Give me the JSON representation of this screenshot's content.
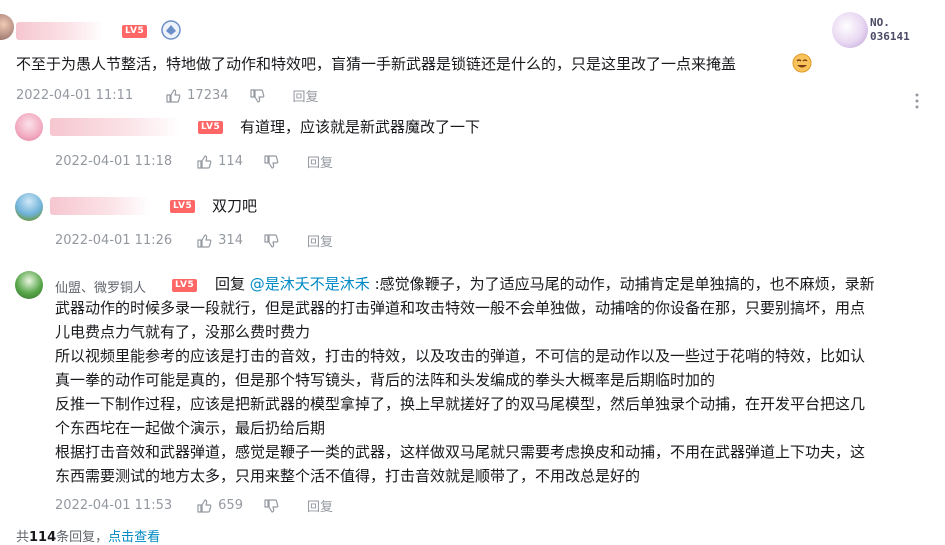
{
  "main_comment": {
    "text": "不至于为愚人节整活，特地做了动作和特效吧，盲猜一手新武器是锁链还是什么的，只是这里改了一点来掩盖",
    "time": "2022-04-01 11:11",
    "likes": "17234",
    "reply_label": "回复",
    "level": "LV5",
    "badge_no_label": "NO.",
    "badge_no_value": "036141"
  },
  "replies": [
    {
      "level": "LV5",
      "text": "有道理，应该就是新武器魔改了一下",
      "time": "2022-04-01 11:18",
      "likes": "114",
      "reply_label": "回复"
    },
    {
      "level": "LV5",
      "text": "双刀吧",
      "time": "2022-04-01 11:26",
      "likes": "314",
      "reply_label": "回复"
    },
    {
      "name": "仙盟、微罗铜人",
      "level": "LV5",
      "reply_prefix": "回复 ",
      "mention": "@是沐夭不是沐禾",
      "line1": " :感觉像鞭子，为了适应马尾的动作，动捕肯定是单独搞的，也不麻烦，录新",
      "line2": "武器动作的时候多录一段就行，但是武器的打击弹道和攻击特效一般不会单独做，动捕啥的你设备在那，只要别搞坏，用点",
      "line3": "儿电费点力气就有了，没那么费时费力",
      "line4": "所以视频里能参考的应该是打击的音效，打击的特效，以及攻击的弹道，不可信的是动作以及一些过于花哨的特效，比如认",
      "line5": "真一拳的动作可能是真的，但是那个特写镜头，背后的法阵和头发编成的拳头大概率是后期临时加的",
      "line6": "反推一下制作过程，应该是把新武器的模型拿掉了，换上早就搓好了的双马尾模型，然后单独录个动捕，在开发平台把这几",
      "line7": "个东西坨在一起做个演示，最后扔给后期",
      "line8": "根据打击音效和武器弹道，感觉是鞭子一类的武器，这样做双马尾就只需要考虑换皮和动捕，不用在武器弹道上下功夫，这",
      "line9": "东西需要测试的地方太多，只用来整个活不值得，打击音效就是顺带了，不用改总是好的",
      "time": "2022-04-01 11:53",
      "likes": "659",
      "reply_label": "回复"
    }
  ],
  "footer": {
    "prefix": "共",
    "count": "114",
    "suffix": "条回复，",
    "link": "点击查看"
  },
  "colors": {
    "accent": "#008ac5",
    "level_badge": "#ff6666",
    "muted": "#9499a0"
  }
}
